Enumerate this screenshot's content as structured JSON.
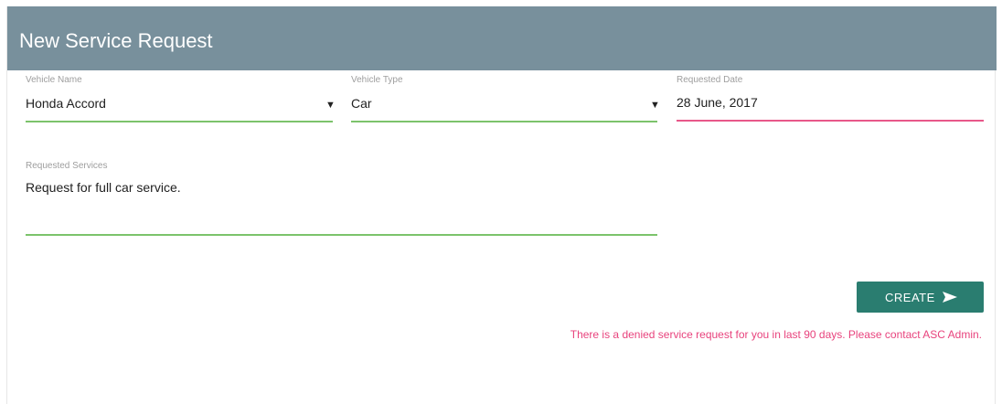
{
  "header": {
    "title": "New Service Request"
  },
  "form": {
    "vehicle_name": {
      "label": "Vehicle Name",
      "value": "Honda Accord"
    },
    "vehicle_type": {
      "label": "Vehicle Type",
      "value": "Car"
    },
    "requested_date": {
      "label": "Requested Date",
      "value": "28 June, 2017"
    },
    "requested_services": {
      "label": "Requested Services",
      "value": "Request for full car service."
    }
  },
  "actions": {
    "create_label": "CREATE",
    "create_icon": "send-icon"
  },
  "messages": {
    "error": "There is a denied service request for you in last 90 days. Please contact ASC Admin."
  },
  "colors": {
    "header_bg": "#78909c",
    "valid_underline": "#7cc36b",
    "invalid_underline": "#e8578a",
    "button_bg": "#2a7d70",
    "error_text": "#e8437d"
  }
}
